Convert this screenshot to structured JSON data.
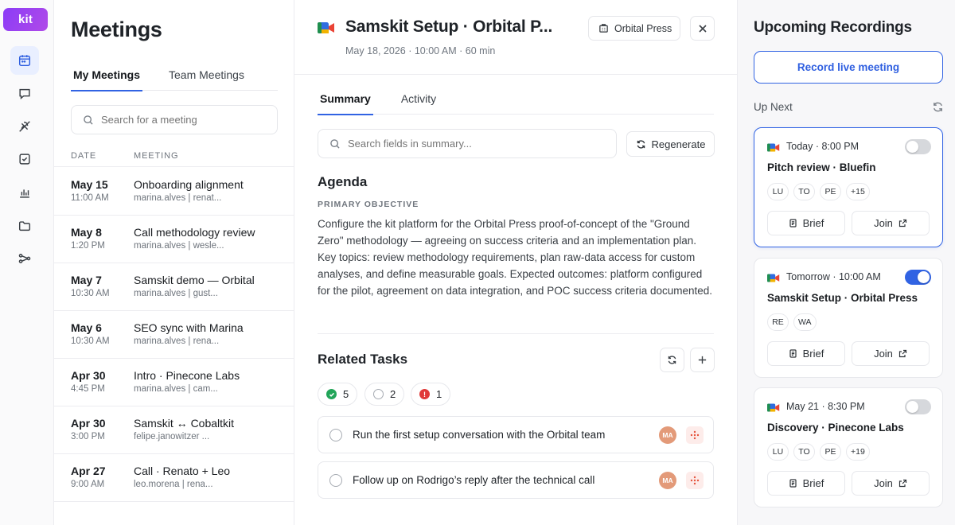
{
  "app": {
    "logo": "kit"
  },
  "meetings": {
    "title": "Meetings",
    "tabs": [
      {
        "label": "My Meetings",
        "active": true
      },
      {
        "label": "Team Meetings",
        "active": false
      }
    ],
    "search_placeholder": "Search for a meeting",
    "columns": {
      "date": "DATE",
      "meeting": "MEETING"
    },
    "rows": [
      {
        "date": "May 15",
        "time": "11:00 AM",
        "name": "Onboarding alignment",
        "people": "marina.alves | renat..."
      },
      {
        "date": "May 8",
        "time": "1:20 PM",
        "name": "Call methodology review",
        "people": "marina.alves | wesle..."
      },
      {
        "date": "May 7",
        "time": "10:30 AM",
        "name": "Samskit demo — Orbital",
        "people": "marina.alves | gust..."
      },
      {
        "date": "May 6",
        "time": "10:30 AM",
        "name": "SEO sync with Marina",
        "people": "marina.alves | rena..."
      },
      {
        "date": "Apr 30",
        "time": "4:45 PM",
        "name": "Intro · Pinecone Labs",
        "people": "marina.alves | cam..."
      },
      {
        "date": "Apr 30",
        "time": "3:00 PM",
        "name": "Samskit ↔ Cobaltkit",
        "people": "felipe.janowitzer ..."
      },
      {
        "date": "Apr 27",
        "time": "9:00 AM",
        "name": "Call · Renato + Leo",
        "people": "leo.morena | rena..."
      }
    ]
  },
  "detail": {
    "title": "Samskit Setup · Orbital P...",
    "subtitle": "May 18, 2026 · 10:00 AM · 60 min",
    "company": "Orbital Press",
    "tabs": [
      {
        "label": "Summary",
        "active": true
      },
      {
        "label": "Activity",
        "active": false
      }
    ],
    "summary_search_placeholder": "Search fields in summary...",
    "regenerate_label": "Regenerate",
    "agenda": {
      "heading": "Agenda",
      "objective_label": "PRIMARY OBJECTIVE",
      "objective_text": "Configure the kit platform for the Orbital Press proof-of-concept of the \"Ground Zero\" methodology — agreeing on success criteria and an implementation plan. Key topics: review methodology requirements, plan raw-data access for custom analyses, and define measurable goals. Expected outcomes: platform configured for the pilot, agreement on data integration, and POC success criteria documented."
    },
    "related_tasks": {
      "heading": "Related Tasks",
      "counts": {
        "done": "5",
        "open": "2",
        "overdue": "1",
        "overdue_mark": "!"
      },
      "tasks": [
        {
          "text": "Run the first setup conversation with the Orbital team",
          "assignee": "MA"
        },
        {
          "text": "Follow up on Rodrigo’s reply after the technical call",
          "assignee": "MA"
        }
      ]
    }
  },
  "upcoming": {
    "title": "Upcoming Recordings",
    "record_label": "Record live meeting",
    "up_next_label": "Up Next",
    "brief_label": "Brief",
    "join_label": "Join",
    "cards": [
      {
        "when": "Today · 8:00 PM",
        "title": "Pitch review · Bluefin",
        "participants": [
          "LU",
          "TO",
          "PE",
          "+15"
        ],
        "recording": false,
        "selected": true
      },
      {
        "when": "Tomorrow · 10:00 AM",
        "title": "Samskit Setup · Orbital Press",
        "participants": [
          "RE",
          "WA"
        ],
        "recording": true,
        "selected": false
      },
      {
        "when": "May 21 · 8:30 PM",
        "title": "Discovery · Pinecone Labs",
        "participants": [
          "LU",
          "TO",
          "PE",
          "+19"
        ],
        "recording": false,
        "selected": false
      }
    ]
  },
  "colors": {
    "accent": "#3163e3",
    "done": "#22a559",
    "alert": "#e03a3a",
    "brand": "#8b3cf7"
  }
}
